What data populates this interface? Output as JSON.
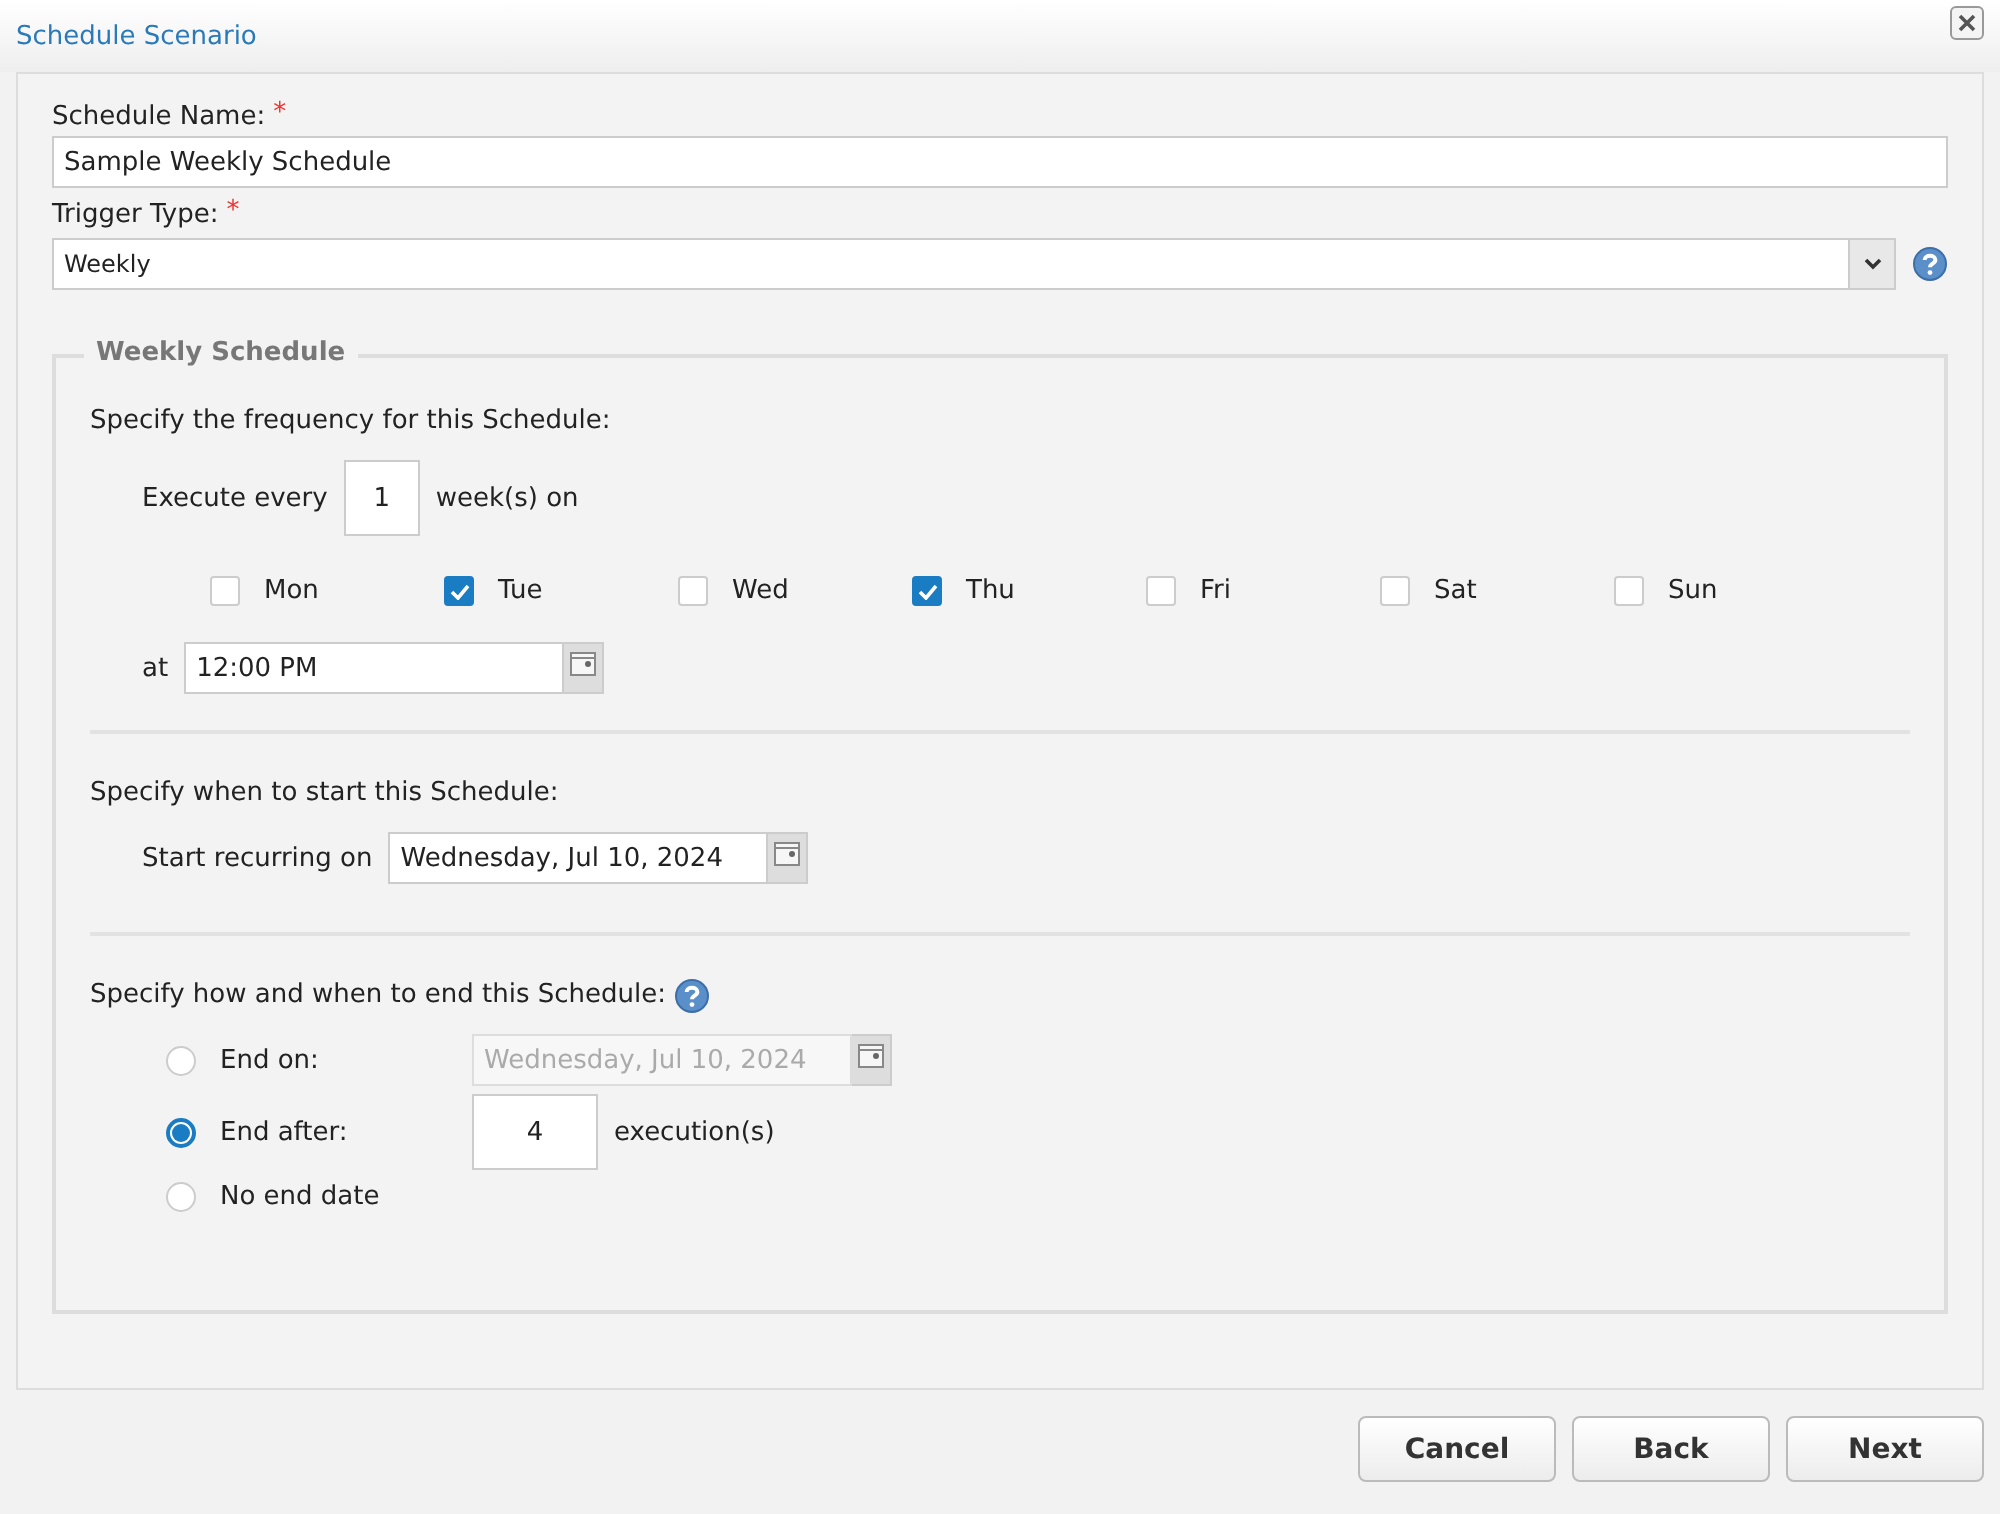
{
  "window": {
    "title": "Schedule Scenario"
  },
  "schedule_name": {
    "label": "Schedule Name:",
    "required_mark": "*",
    "value": "Sample Weekly Schedule"
  },
  "trigger_type": {
    "label": "Trigger Type:",
    "required_mark": "*",
    "value": "Weekly"
  },
  "weekly_schedule": {
    "legend": "Weekly Schedule",
    "frequency": {
      "heading": "Specify the frequency for this Schedule:",
      "prefix": "Execute every",
      "value": "1",
      "suffix": "week(s) on",
      "days": [
        {
          "label": "Mon",
          "checked": false
        },
        {
          "label": "Tue",
          "checked": true
        },
        {
          "label": "Wed",
          "checked": false
        },
        {
          "label": "Thu",
          "checked": true
        },
        {
          "label": "Fri",
          "checked": false
        },
        {
          "label": "Sat",
          "checked": false
        },
        {
          "label": "Sun",
          "checked": false
        }
      ],
      "time_label": "at",
      "time_value": "12:00 PM"
    },
    "start": {
      "heading": "Specify when to start this Schedule:",
      "label": "Start recurring on",
      "value": "Wednesday, Jul 10, 2024"
    },
    "end": {
      "heading": "Specify how and when to end this Schedule:",
      "options": [
        {
          "label": "End on:",
          "selected": false,
          "kind": "date",
          "value": "Wednesday, Jul 10, 2024",
          "disabled": true
        },
        {
          "label": "End after:",
          "selected": true,
          "kind": "count",
          "value": "4",
          "suffix": "execution(s)"
        },
        {
          "label": "No end date",
          "selected": false,
          "kind": "none"
        }
      ]
    }
  },
  "buttons": [
    "Cancel",
    "Back",
    "Next"
  ]
}
